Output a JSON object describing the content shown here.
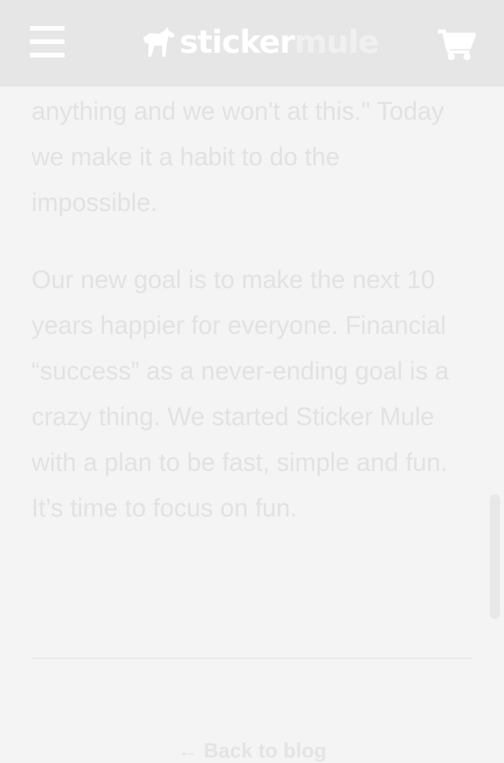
{
  "header": {
    "logo_part1": "sticker",
    "logo_part2": "mule"
  },
  "article": {
    "paragraph_continued": "anything and we won't at this.\" Today we make it a habit to do the impossible.",
    "paragraph_final": "Our new goal is to make the next 10 years happier for everyone. Financial “success” as a never-ending goal is a crazy thing. We started Sticker Mule with a plan to be fast, simple and fun. It’s time to focus on fun."
  },
  "footer": {
    "back_link": "← Back to blog"
  },
  "icons": {
    "menu": "hamburger-icon",
    "logo": "mule-logo-icon",
    "cart": "cart-icon"
  },
  "colors": {
    "header_bg": "#e6e6e6",
    "page_bg": "#f4f4f4",
    "text": "#e2e2e2"
  }
}
